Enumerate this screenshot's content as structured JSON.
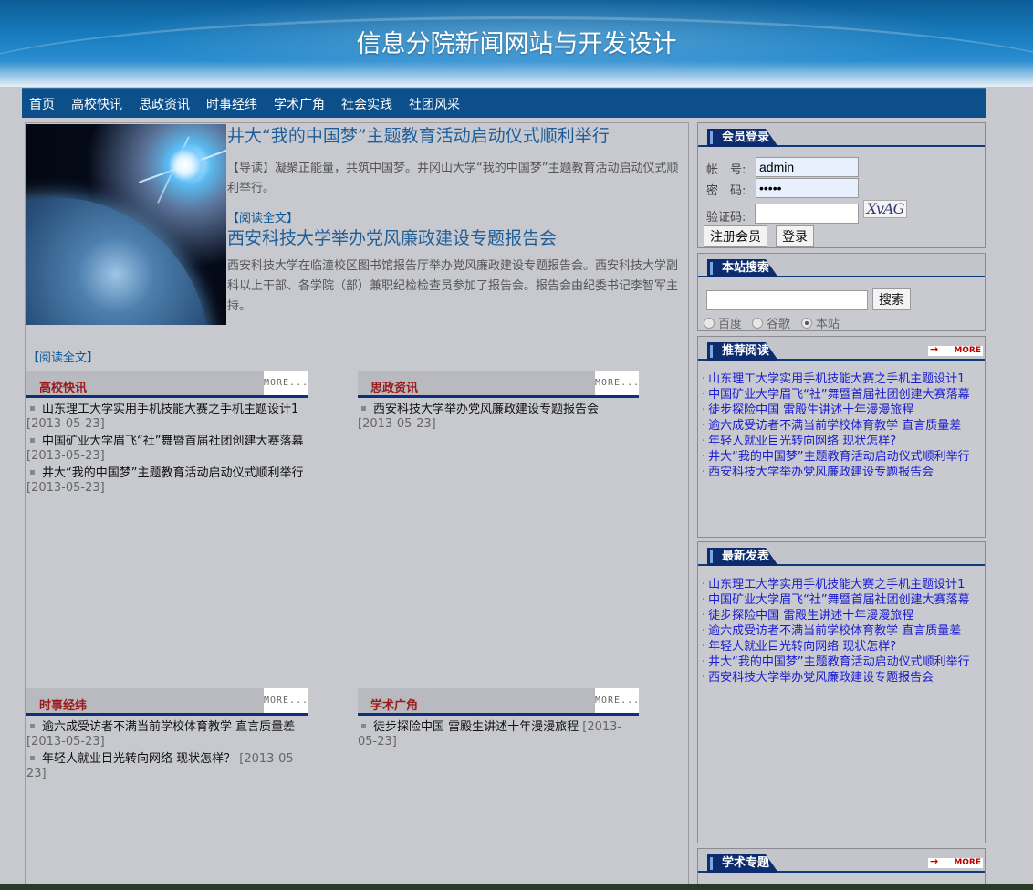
{
  "site": {
    "title": "信息分院新闻网站与开发设计"
  },
  "nav": [
    "首页",
    "高校快讯",
    "思政资讯",
    "时事经纬",
    "学术广角",
    "社会实践",
    "社团风采"
  ],
  "featured": [
    {
      "title": "井大“我的中国梦”主题教育活动启动仪式顺利举行",
      "summary": "【导读】凝聚正能量，共筑中国梦。井冈山大学“我的中国梦”主题教育活动启动仪式顺利举行。",
      "read_more": "【阅读全文】"
    },
    {
      "title": "西安科技大学举办党风廉政建设专题报告会",
      "summary": "西安科技大学在临潼校区图书馆报告厅举办党风廉政建设专题报告会。西安科技大学副科以上干部、各学院（部）兼职纪检检查员参加了报告会。报告会由纪委书记李智军主持。",
      "read_more": "【阅读全文】"
    }
  ],
  "more_label": "MORE...",
  "sections": {
    "gaoxiao": {
      "title": "高校快讯",
      "items": [
        {
          "title": "山东理工大学实用手机技能大赛之手机主题设计1",
          "date": "[2013-05-23]"
        },
        {
          "title": "中国矿业大学眉飞“社”舞暨首届社团创建大赛落幕",
          "date": "[2013-05-23]"
        },
        {
          "title": "井大“我的中国梦”主题教育活动启动仪式顺利举行",
          "date": "[2013-05-23]"
        }
      ]
    },
    "sizheng": {
      "title": "思政资讯",
      "items": [
        {
          "title": "西安科技大学举办党风廉政建设专题报告会",
          "date": "[2013-05-23]"
        }
      ]
    },
    "shishi": {
      "title": "时事经纬",
      "items": [
        {
          "title": "逾六成受访者不满当前学校体育教学 直言质量差",
          "date": "[2013-05-23]"
        },
        {
          "title": "年轻人就业目光转向网络 现状怎样？",
          "date": "[2013-05-23]"
        }
      ]
    },
    "xueshu": {
      "title": "学术广角",
      "items": [
        {
          "title": "徒步探险中国 雷殿生讲述十年漫漫旅程",
          "date": "[2013-05-23]"
        }
      ]
    }
  },
  "login": {
    "title": "会员登录",
    "account_label": "帐　号:",
    "account_value": "admin",
    "password_label": "密　码:",
    "password_value": "•••••",
    "captcha_label": "验证码:",
    "captcha_text": "XvAG",
    "register_button": "注册会员",
    "login_button": "登录"
  },
  "search": {
    "title": "本站搜索",
    "button": "搜索",
    "options": [
      "百度",
      "谷歌",
      "本站"
    ],
    "selected": "本站"
  },
  "recommended": {
    "title": "推荐阅读",
    "more": "MORE",
    "items": [
      "山东理工大学实用手机技能大赛之手机主题设计1",
      "中国矿业大学眉飞“社”舞暨首届社团创建大赛落幕",
      "徒步探险中国 雷殿生讲述十年漫漫旅程",
      "逾六成受访者不满当前学校体育教学 直言质量差",
      "年轻人就业目光转向网络 现状怎样?",
      "井大“我的中国梦”主题教育活动启动仪式顺利举行",
      "西安科技大学举办党风廉政建设专题报告会"
    ]
  },
  "latest": {
    "title": "最新发表",
    "items": [
      "山东理工大学实用手机技能大赛之手机主题设计1",
      "中国矿业大学眉飞“社”舞暨首届社团创建大赛落幕",
      "徒步探险中国 雷殿生讲述十年漫漫旅程",
      "逾六成受访者不满当前学校体育教学 直言质量差",
      "年轻人就业目光转向网络 现状怎样?",
      "井大“我的中国梦”主题教育活动启动仪式顺利举行",
      "西安科技大学举办党风廉政建设专题报告会"
    ]
  },
  "topics": {
    "title": "学术专题",
    "more": "MORE"
  },
  "colors": {
    "accent": "#0c2c6e",
    "nav": "#0d4f8a",
    "link": "#1a1ccf",
    "section_title": "#9b1a1a"
  }
}
